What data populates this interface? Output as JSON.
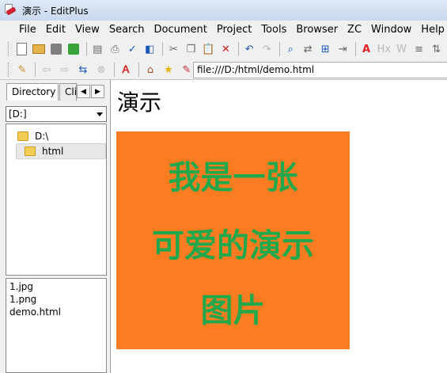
{
  "window": {
    "title": "演示 - EditPlus"
  },
  "menu": {
    "items": [
      "File",
      "Edit",
      "View",
      "Search",
      "Document",
      "Project",
      "Tools",
      "Browser",
      "ZC",
      "Window",
      "Help"
    ]
  },
  "toolbar": {
    "address": "file:///D:/html/demo.html"
  },
  "sidebar": {
    "tabs": {
      "directory": "Directory",
      "cliptext": "Cliptext"
    },
    "drive": "[D:]",
    "tree": [
      {
        "label": "D:\\"
      },
      {
        "label": "html"
      }
    ],
    "files": [
      "1.jpg",
      "1.png",
      "demo.html"
    ]
  },
  "page": {
    "heading": "演示",
    "image_lines": [
      "我是一张",
      "可爱的演示",
      "图片"
    ],
    "image_bg": "#fd7c21",
    "image_text_color": "#22a84a"
  }
}
